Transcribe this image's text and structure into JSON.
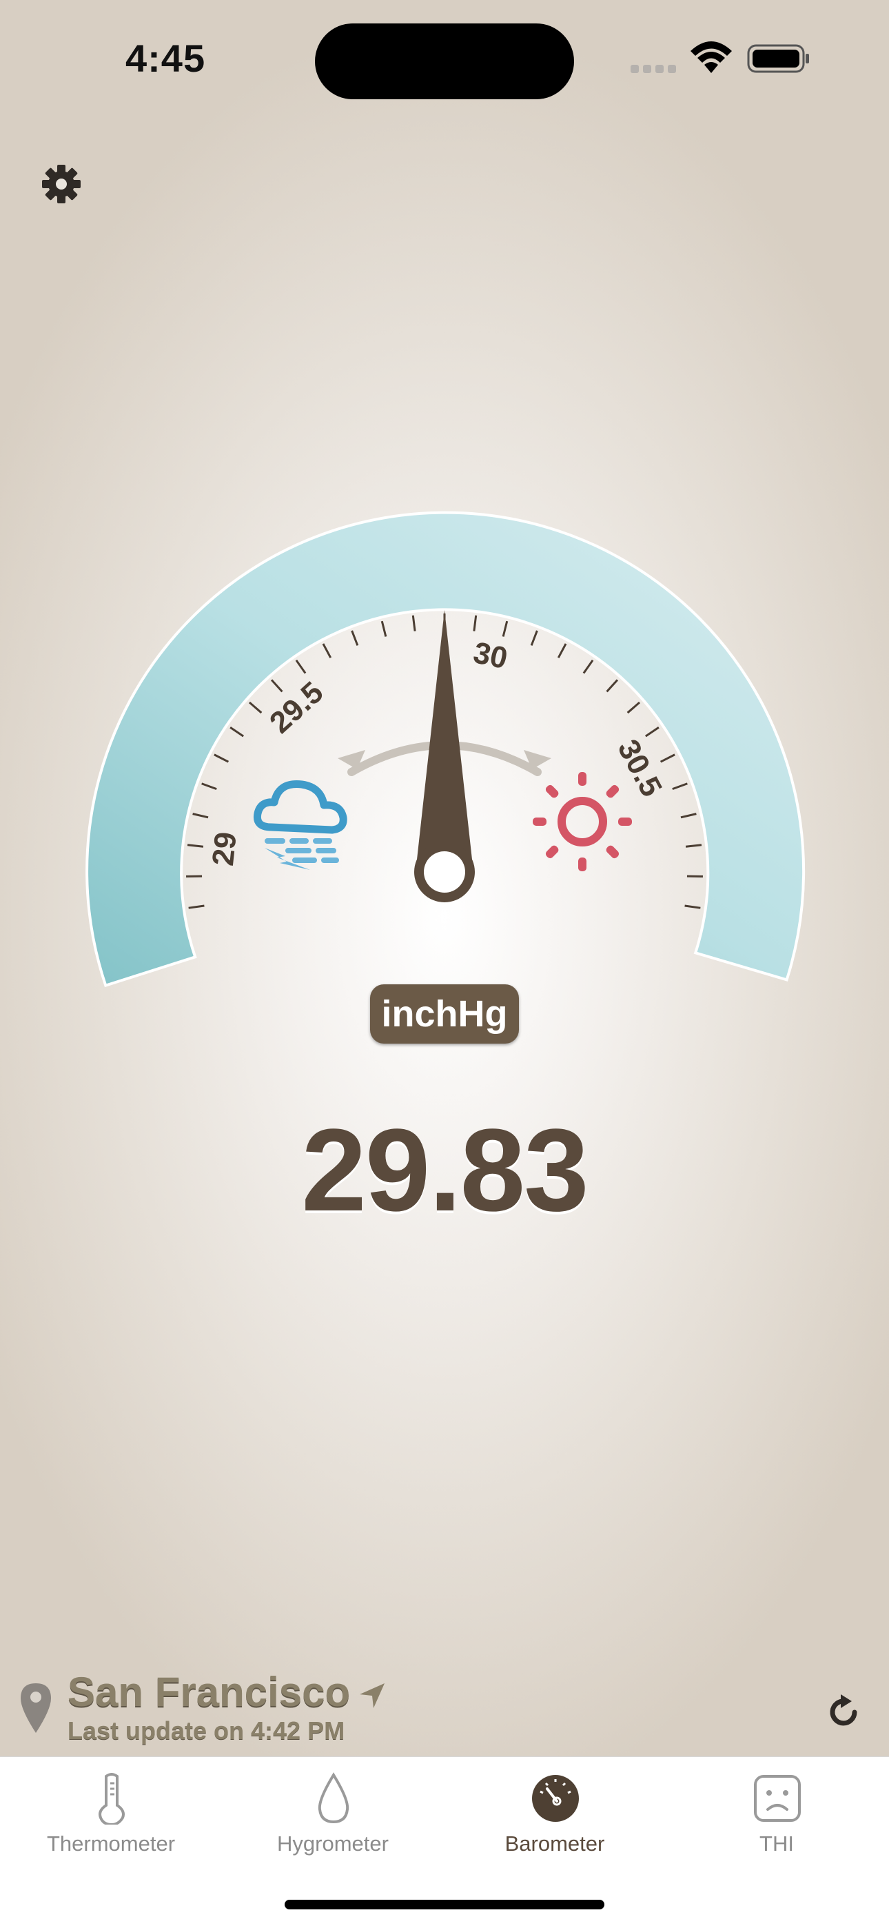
{
  "status_bar": {
    "time": "4:45"
  },
  "gauge": {
    "tick_labels": [
      "29",
      "29.5",
      "30",
      "30.5"
    ],
    "reading": 29.83,
    "left_icon": "storm-cloud-icon",
    "right_icon": "sun-icon",
    "colors": {
      "arc": "#9fd4da",
      "needle": "#5a4a3c",
      "storm": "#3f9bc9",
      "sun": "#d45565",
      "text": "#4a3d32"
    }
  },
  "unit": "inchHg",
  "pressure_value": "29.83",
  "location": {
    "city": "San Francisco",
    "last_update": "Last update on 4:42 PM"
  },
  "tabs": [
    {
      "label": "Thermometer",
      "icon": "thermometer-icon",
      "active": false
    },
    {
      "label": "Hygrometer",
      "icon": "water-drop-icon",
      "active": false
    },
    {
      "label": "Barometer",
      "icon": "barometer-icon",
      "active": true
    },
    {
      "label": "THI",
      "icon": "sad-face-icon",
      "active": false
    }
  ]
}
